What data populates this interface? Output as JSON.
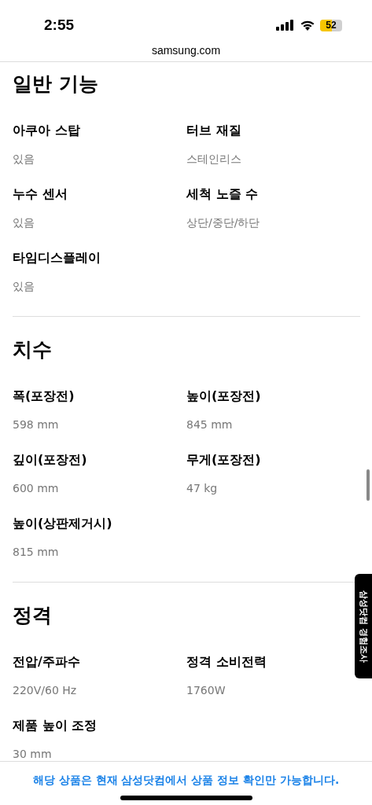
{
  "status_bar": {
    "time": "2:55",
    "battery": "52"
  },
  "address_bar": {
    "url": "samsung.com"
  },
  "sections": [
    {
      "title": "일반 기능",
      "specs": [
        {
          "label": "아쿠아 스탑",
          "value": "있음"
        },
        {
          "label": "터브 재질",
          "value": "스테인리스"
        },
        {
          "label": "누수 센서",
          "value": "있음"
        },
        {
          "label": "세척 노즐 수",
          "value": "상단/중단/하단"
        },
        {
          "label": "타임디스플레이",
          "value": "있음"
        }
      ]
    },
    {
      "title": "치수",
      "specs": [
        {
          "label": "폭(포장전)",
          "value": "598 mm"
        },
        {
          "label": "높이(포장전)",
          "value": "845 mm"
        },
        {
          "label": "깊이(포장전)",
          "value": "600 mm"
        },
        {
          "label": "무게(포장전)",
          "value": "47 kg"
        },
        {
          "label": "높이(상판제거시)",
          "value": "815 mm"
        }
      ]
    },
    {
      "title": "정격",
      "specs": [
        {
          "label": "전압/주파수",
          "value": "220V/60 Hz"
        },
        {
          "label": "정격 소비전력",
          "value": "1760W"
        },
        {
          "label": "제품 높이 조정",
          "value": "30 mm"
        }
      ]
    }
  ],
  "survey_tab": {
    "label": "삼성닷컴 경험조사"
  },
  "notice": "해당 상품은 현재 삼성닷컴에서 상품 정보 확인만 가능합니다."
}
